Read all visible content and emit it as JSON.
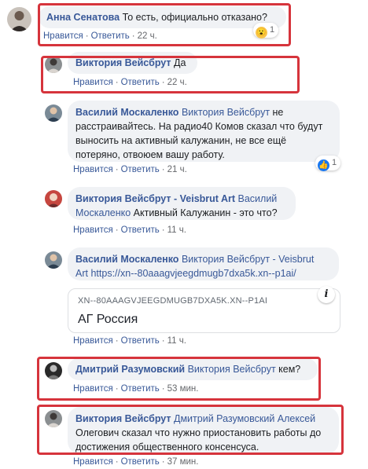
{
  "actions": {
    "like": "Нравится",
    "reply": "Ответить"
  },
  "comments": [
    {
      "name": "Анна Сенатова",
      "mention": "",
      "text": "То есть, официально отказано?",
      "time": "22 ч.",
      "reaction": {
        "icon": "wow-emoji-icon",
        "count": "1"
      }
    },
    {
      "name": "Виктория Вейсбрут",
      "mention": "",
      "text": "Да",
      "time": "22 ч."
    },
    {
      "name": "Василий Москаленко",
      "mention": "Виктория Вейсбрут",
      "text_lines": [
        "не",
        "расстраивайтесь. На радио40 Комов сказал что будут",
        "выносить на активный калужанин, не все ещё",
        "потеряно, отвоюем вашу работу."
      ],
      "time": "21 ч.",
      "reaction": {
        "icon": "like-icon",
        "count": "1"
      }
    },
    {
      "name": "Виктория Вейсбрут - Veisbrut Art",
      "mention_lines": [
        "Василий",
        "Москаленко"
      ],
      "text": "Активный Калужанин - это что?",
      "time": "11 ч."
    },
    {
      "name": "Василий Москаленко",
      "mention_lines": [
        "Виктория Вейсбрут - Veisbrut",
        "Art"
      ],
      "text": "https://xn--80aaagvjeegdmugb7dxa5k.xn--p1ai/",
      "time": "11 ч.",
      "link_card": {
        "domain": "XN--80AAAGVJEEGDMUGB7DXA5K.XN--P1AI",
        "title": "АГ Россия",
        "info": "i"
      }
    },
    {
      "name": "Дмитрий Разумовский",
      "mention": "Виктория Вейсбрут",
      "text": "кем?",
      "time": "53 мин."
    },
    {
      "name": "Виктория Вейсбрут",
      "mention": "Дмитрий Разумовский Алексей",
      "text_lines": [
        "Олегович сказал что нужно приостановить работы до",
        "достижения общественного консенсуса."
      ],
      "time": "37 мин."
    }
  ],
  "colors": {
    "name": "#385898",
    "highlight": "#d6343c",
    "bubble": "#f0f2f5"
  }
}
